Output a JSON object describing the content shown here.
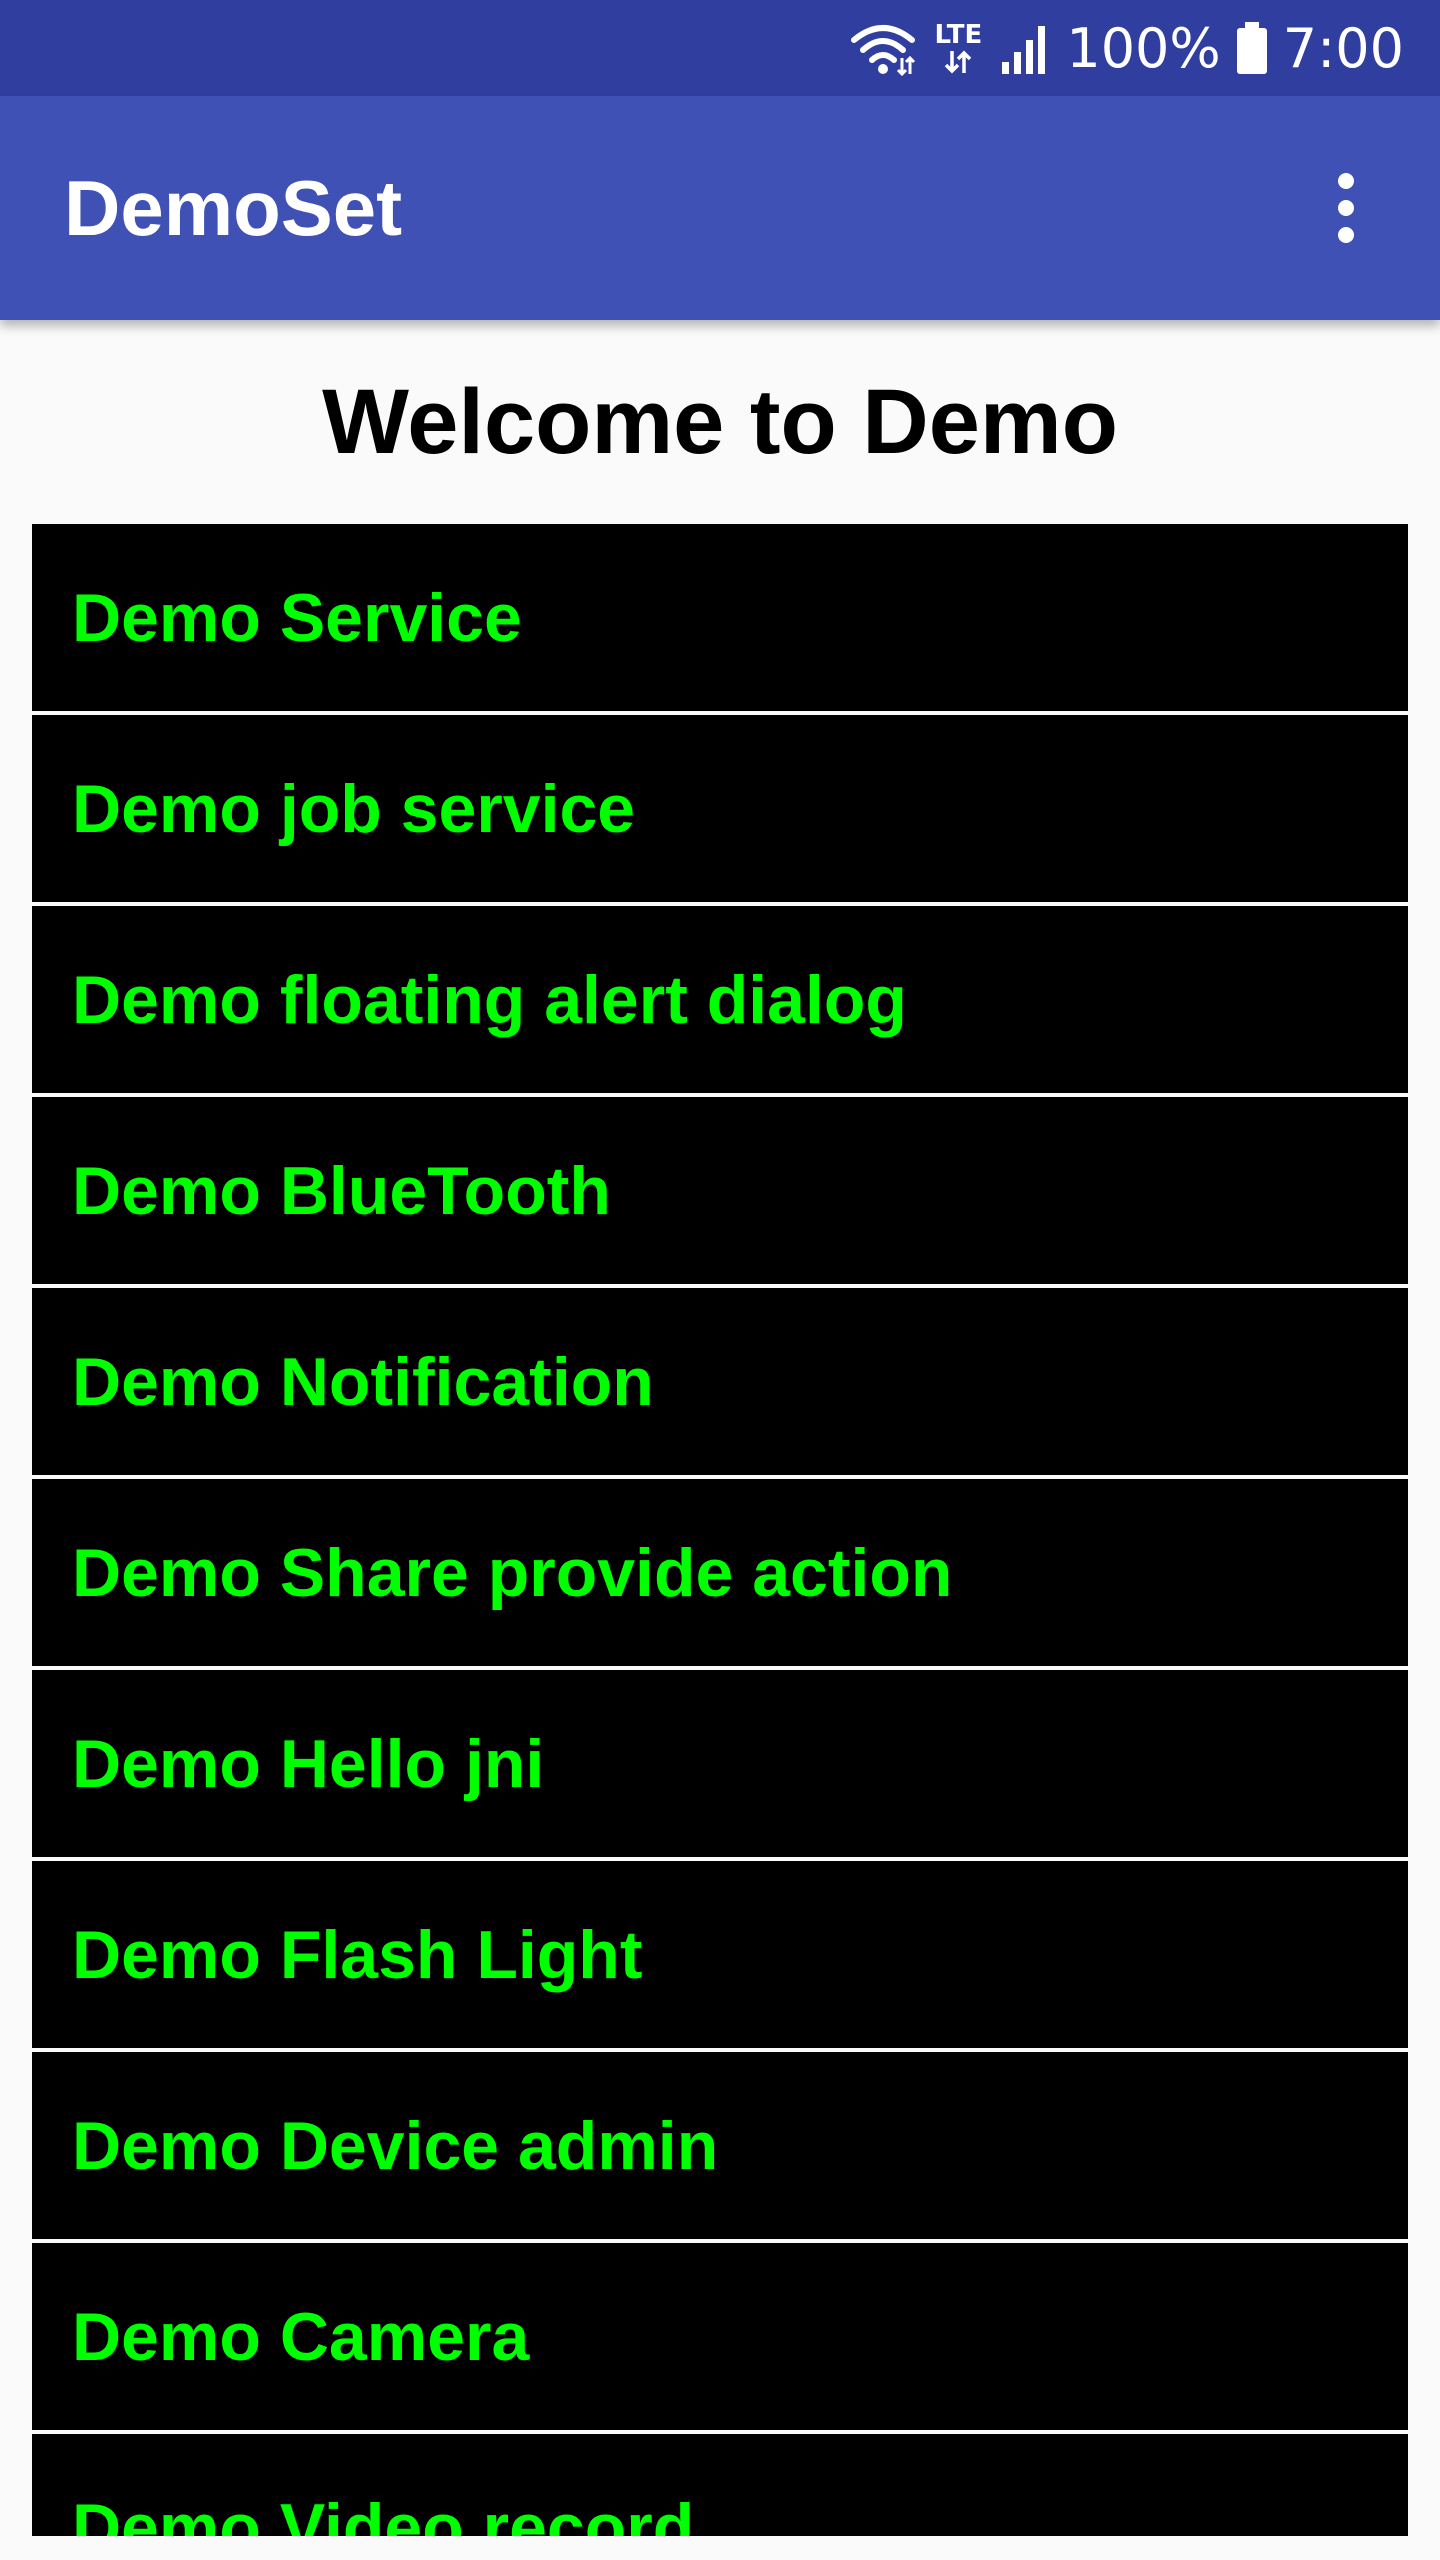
{
  "status_bar": {
    "wifi_icon": "wifi-icon",
    "lte_label": "LTE",
    "signal_icon": "signal-icon",
    "battery_percent": "100%",
    "battery_icon": "battery-icon",
    "time": "7:00"
  },
  "app_bar": {
    "title": "DemoSet",
    "overflow_icon": "more-vert-icon"
  },
  "main": {
    "welcome": "Welcome to Demo",
    "items": [
      {
        "label": "Demo Service"
      },
      {
        "label": "Demo job service"
      },
      {
        "label": "Demo floating alert dialog"
      },
      {
        "label": "Demo BlueTooth"
      },
      {
        "label": "Demo Notification"
      },
      {
        "label": "Demo Share provide action"
      },
      {
        "label": "Demo Hello jni"
      },
      {
        "label": "Demo Flash Light"
      },
      {
        "label": "Demo Device admin"
      },
      {
        "label": "Demo Camera"
      },
      {
        "label": "Demo Video record"
      }
    ]
  },
  "colors": {
    "status_bar": "#303F9F",
    "app_bar": "#3F51B5",
    "item_background": "#000000",
    "item_text": "#00FF00",
    "page_background": "#FAFAFA"
  }
}
